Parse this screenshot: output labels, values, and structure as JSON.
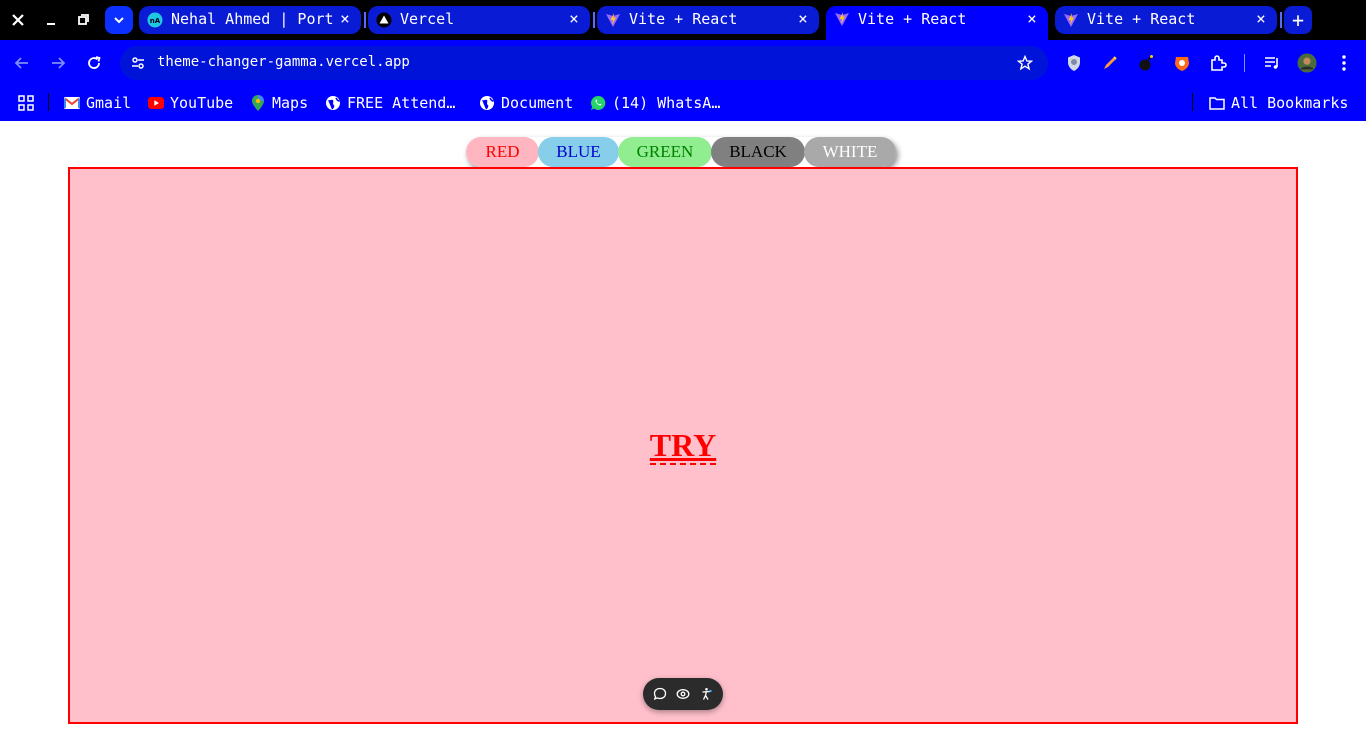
{
  "browser": {
    "tabs": [
      {
        "title": "Nehal Ahmed | Portfolio",
        "favicon": "portfolio-icon",
        "active": false
      },
      {
        "title": "Vercel",
        "favicon": "vercel-triangle-icon",
        "active": false
      },
      {
        "title": "Vite + React",
        "favicon": "vite-icon",
        "active": false
      },
      {
        "title": "Vite + React",
        "favicon": "vite-icon",
        "active": true
      },
      {
        "title": "Vite + React",
        "favicon": "vite-icon",
        "active": false
      }
    ],
    "tab_close_glyph": "×",
    "new_tab_glyph": "+",
    "url": "theme-changer-gamma.vercel.app",
    "bookmarks": [
      {
        "label": "Gmail",
        "icon": "gmail-icon"
      },
      {
        "label": "YouTube",
        "icon": "youtube-icon"
      },
      {
        "label": "Maps",
        "icon": "maps-icon"
      },
      {
        "label": "FREE Attend…",
        "icon": "globe-icon"
      },
      {
        "label": "Document",
        "icon": "globe-icon"
      },
      {
        "label": "(14) WhatsA…",
        "icon": "whatsapp-icon"
      }
    ],
    "all_bookmarks_label": "All Bookmarks",
    "colors": {
      "tabstrip": "#000000",
      "toolbar": "#0000ff",
      "active_tab": "#0000ff"
    }
  },
  "page": {
    "theme_buttons": [
      {
        "label": "RED",
        "bg": "#ffb6c1",
        "fg": "#ff0000"
      },
      {
        "label": "BLUE",
        "bg": "#87ceeb",
        "fg": "#0000cd"
      },
      {
        "label": "GREEN",
        "bg": "#90ee90",
        "fg": "#008000"
      },
      {
        "label": "BLACK",
        "bg": "#808080",
        "fg": "#000000"
      },
      {
        "label": "WHITE",
        "bg": "#a9a9a9",
        "fg": "#ffffff"
      }
    ],
    "preview": {
      "text": "TRY",
      "bg": "#ffc0cb",
      "fg": "#ff0000",
      "border": "#ff0000"
    },
    "vercel_toolbar": {
      "icons": [
        "comment-icon",
        "eye-icon",
        "accessibility-icon"
      ]
    }
  }
}
